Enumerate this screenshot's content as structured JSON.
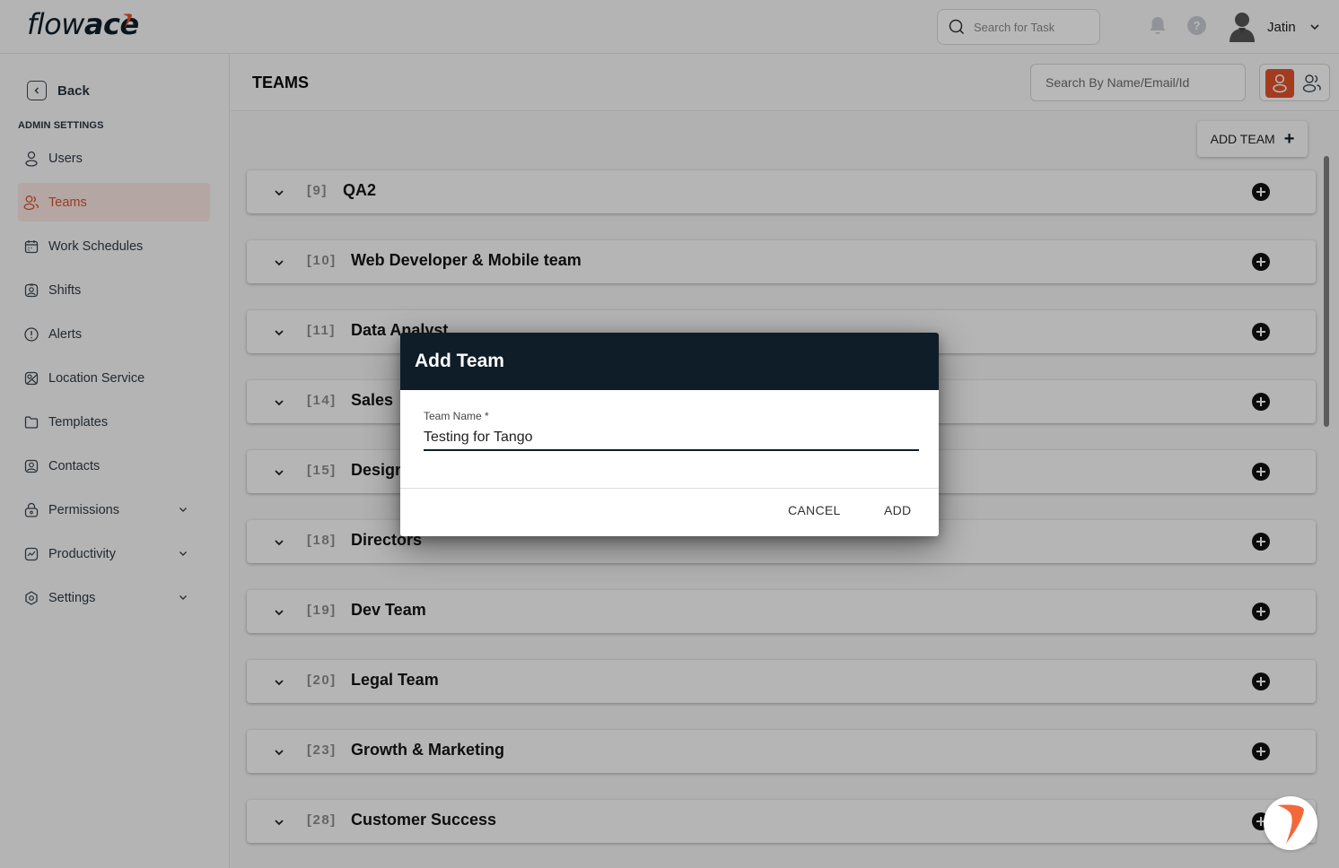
{
  "app": {
    "logo_light": "flow",
    "logo_bold": "ace",
    "brand_color": "#e2542b"
  },
  "topbar": {
    "task_search_placeholder": "Search for Task",
    "user_name": "Jatin"
  },
  "sidebar": {
    "back_label": "Back",
    "section_title": "ADMIN SETTINGS",
    "items": [
      {
        "label": "Users",
        "icon": "user-icon",
        "active": false,
        "expandable": false
      },
      {
        "label": "Teams",
        "icon": "users-icon",
        "active": true,
        "expandable": false
      },
      {
        "label": "Work Schedules",
        "icon": "calendar-icon",
        "active": false,
        "expandable": false
      },
      {
        "label": "Shifts",
        "icon": "badge-icon",
        "active": false,
        "expandable": false
      },
      {
        "label": "Alerts",
        "icon": "alert-icon",
        "active": false,
        "expandable": false
      },
      {
        "label": "Location Service",
        "icon": "map-icon",
        "active": false,
        "expandable": false
      },
      {
        "label": "Templates",
        "icon": "folder-icon",
        "active": false,
        "expandable": false
      },
      {
        "label": "Contacts",
        "icon": "contact-icon",
        "active": false,
        "expandable": false
      },
      {
        "label": "Permissions",
        "icon": "lock-icon",
        "active": false,
        "expandable": true
      },
      {
        "label": "Productivity",
        "icon": "chart-icon",
        "active": false,
        "expandable": true
      },
      {
        "label": "Settings",
        "icon": "settings-icon",
        "active": false,
        "expandable": true
      }
    ]
  },
  "main": {
    "title": "TEAMS",
    "member_search_placeholder": "Search By Name/Email/Id",
    "add_team_label": "ADD TEAM",
    "teams": [
      {
        "id": "[9]",
        "name": "QA2"
      },
      {
        "id": "[10]",
        "name": "Web Developer & Mobile team"
      },
      {
        "id": "[11]",
        "name": "Data Analyst"
      },
      {
        "id": "[14]",
        "name": "Sales"
      },
      {
        "id": "[15]",
        "name": "Design"
      },
      {
        "id": "[18]",
        "name": "Directors"
      },
      {
        "id": "[19]",
        "name": "Dev Team"
      },
      {
        "id": "[20]",
        "name": "Legal Team"
      },
      {
        "id": "[23]",
        "name": "Growth & Marketing"
      },
      {
        "id": "[28]",
        "name": "Customer Success"
      }
    ]
  },
  "dialog": {
    "title": "Add Team",
    "field_label": "Team Name *",
    "field_value": "Testing for Tango",
    "cancel_label": "CANCEL",
    "add_label": "ADD"
  }
}
